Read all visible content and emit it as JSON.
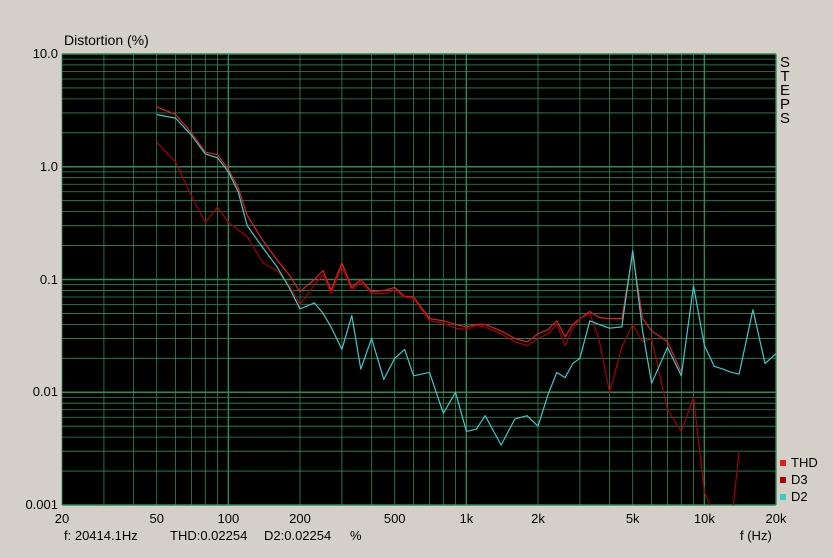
{
  "colors": {
    "background": "#d4d0c8",
    "plot_bg": "#000000",
    "grid": "#2e8b57",
    "thd": "#e02020",
    "d3": "#a80000",
    "d2": "#40c8c8"
  },
  "status": {
    "freq": "f: 20414.1Hz",
    "thd": "THD:0.02254",
    "d2": "D2:0.02254",
    "unit": "%"
  },
  "steps_label": [
    "S",
    "T",
    "E",
    "P",
    "S"
  ],
  "chart_data": {
    "type": "line",
    "ylabel": "Distortion (%)",
    "xlabel": "f (Hz)",
    "xscale": "log",
    "yscale": "log",
    "xlim": [
      20,
      20000
    ],
    "ylim": [
      0.001,
      10
    ],
    "grid": true,
    "legend_position": "bottom-right",
    "xticks": [
      {
        "v": 20,
        "label": "20"
      },
      {
        "v": 50,
        "label": "50"
      },
      {
        "v": 100,
        "label": "100"
      },
      {
        "v": 200,
        "label": "200"
      },
      {
        "v": 500,
        "label": "500"
      },
      {
        "v": 1000,
        "label": "1k"
      },
      {
        "v": 2000,
        "label": "2k"
      },
      {
        "v": 5000,
        "label": "5k"
      },
      {
        "v": 10000,
        "label": "10k"
      },
      {
        "v": 20000,
        "label": "20k"
      }
    ],
    "yticks": [
      {
        "v": 10,
        "label": "10.0"
      },
      {
        "v": 1,
        "label": "1.0"
      },
      {
        "v": 0.1,
        "label": "0.1"
      },
      {
        "v": 0.01,
        "label": "0.01"
      },
      {
        "v": 0.001,
        "label": "0.001"
      }
    ],
    "series": [
      {
        "name": "THD",
        "color": "#e02020",
        "points": [
          [
            50,
            3.4
          ],
          [
            60,
            2.9
          ],
          [
            70,
            2.0
          ],
          [
            80,
            1.35
          ],
          [
            90,
            1.28
          ],
          [
            100,
            0.95
          ],
          [
            110,
            0.65
          ],
          [
            120,
            0.37
          ],
          [
            140,
            0.22
          ],
          [
            160,
            0.15
          ],
          [
            180,
            0.11
          ],
          [
            200,
            0.078
          ],
          [
            230,
            0.1
          ],
          [
            250,
            0.12
          ],
          [
            270,
            0.08
          ],
          [
            300,
            0.14
          ],
          [
            330,
            0.085
          ],
          [
            360,
            0.1
          ],
          [
            400,
            0.078
          ],
          [
            450,
            0.08
          ],
          [
            500,
            0.085
          ],
          [
            550,
            0.071
          ],
          [
            600,
            0.07
          ],
          [
            700,
            0.045
          ],
          [
            800,
            0.043
          ],
          [
            900,
            0.04
          ],
          [
            1000,
            0.038
          ],
          [
            1100,
            0.04
          ],
          [
            1200,
            0.04
          ],
          [
            1400,
            0.035
          ],
          [
            1600,
            0.03
          ],
          [
            1800,
            0.028
          ],
          [
            2000,
            0.033
          ],
          [
            2200,
            0.036
          ],
          [
            2400,
            0.043
          ],
          [
            2600,
            0.031
          ],
          [
            2800,
            0.04
          ],
          [
            3000,
            0.045
          ],
          [
            3300,
            0.052
          ],
          [
            3600,
            0.046
          ],
          [
            4000,
            0.045
          ],
          [
            4500,
            0.045
          ],
          [
            5000,
            0.17
          ],
          [
            5500,
            0.045
          ],
          [
            6000,
            0.035
          ],
          [
            7000,
            0.028
          ],
          [
            8000,
            0.015
          ]
        ]
      },
      {
        "name": "D3",
        "color": "#a80000",
        "points": [
          [
            50,
            1.65
          ],
          [
            60,
            1.1
          ],
          [
            70,
            0.55
          ],
          [
            80,
            0.32
          ],
          [
            90,
            0.44
          ],
          [
            100,
            0.32
          ],
          [
            120,
            0.24
          ],
          [
            140,
            0.14
          ],
          [
            160,
            0.12
          ],
          [
            180,
            0.09
          ],
          [
            200,
            0.06
          ],
          [
            230,
            0.09
          ],
          [
            250,
            0.11
          ],
          [
            270,
            0.075
          ],
          [
            300,
            0.13
          ],
          [
            330,
            0.08
          ],
          [
            360,
            0.095
          ],
          [
            400,
            0.075
          ],
          [
            450,
            0.075
          ],
          [
            500,
            0.08
          ],
          [
            550,
            0.07
          ],
          [
            600,
            0.068
          ],
          [
            700,
            0.043
          ],
          [
            800,
            0.041
          ],
          [
            900,
            0.037
          ],
          [
            1000,
            0.036
          ],
          [
            1100,
            0.039
          ],
          [
            1200,
            0.038
          ],
          [
            1400,
            0.033
          ],
          [
            1600,
            0.028
          ],
          [
            1800,
            0.026
          ],
          [
            2000,
            0.03
          ],
          [
            2200,
            0.033
          ],
          [
            2400,
            0.04
          ],
          [
            2600,
            0.026
          ],
          [
            2800,
            0.037
          ],
          [
            3000,
            0.045
          ],
          [
            3300,
            0.05
          ],
          [
            3600,
            0.03
          ],
          [
            4000,
            0.01
          ],
          [
            4500,
            0.025
          ],
          [
            5000,
            0.04
          ],
          [
            5500,
            0.028
          ],
          [
            6000,
            0.03
          ],
          [
            7000,
            0.007
          ],
          [
            8000,
            0.0045
          ],
          [
            9000,
            0.009
          ],
          [
            10000,
            0.0013
          ],
          [
            11000,
            0.0008
          ],
          [
            12000,
            0.0009
          ],
          [
            13000,
            0.0007
          ],
          [
            14000,
            0.003
          ]
        ]
      },
      {
        "name": "D2",
        "color": "#40c8c8",
        "points": [
          [
            50,
            2.9
          ],
          [
            60,
            2.7
          ],
          [
            70,
            1.9
          ],
          [
            80,
            1.3
          ],
          [
            90,
            1.2
          ],
          [
            100,
            0.9
          ],
          [
            110,
            0.6
          ],
          [
            120,
            0.3
          ],
          [
            140,
            0.19
          ],
          [
            160,
            0.13
          ],
          [
            180,
            0.085
          ],
          [
            200,
            0.055
          ],
          [
            230,
            0.062
          ],
          [
            250,
            0.05
          ],
          [
            270,
            0.038
          ],
          [
            300,
            0.024
          ],
          [
            330,
            0.048
          ],
          [
            360,
            0.016
          ],
          [
            400,
            0.03
          ],
          [
            450,
            0.013
          ],
          [
            500,
            0.02
          ],
          [
            550,
            0.024
          ],
          [
            600,
            0.014
          ],
          [
            700,
            0.015
          ],
          [
            800,
            0.0065
          ],
          [
            900,
            0.01
          ],
          [
            1000,
            0.0045
          ],
          [
            1100,
            0.0047
          ],
          [
            1200,
            0.0062
          ],
          [
            1400,
            0.0034
          ],
          [
            1600,
            0.0058
          ],
          [
            1800,
            0.0062
          ],
          [
            2000,
            0.005
          ],
          [
            2200,
            0.0095
          ],
          [
            2400,
            0.015
          ],
          [
            2600,
            0.0135
          ],
          [
            2800,
            0.018
          ],
          [
            3000,
            0.02
          ],
          [
            3300,
            0.043
          ],
          [
            3600,
            0.04
          ],
          [
            4000,
            0.037
          ],
          [
            4500,
            0.038
          ],
          [
            5000,
            0.18
          ],
          [
            5500,
            0.035
          ],
          [
            6000,
            0.012
          ],
          [
            7000,
            0.025
          ],
          [
            8000,
            0.014
          ],
          [
            9000,
            0.088
          ],
          [
            10000,
            0.026
          ],
          [
            11000,
            0.017
          ],
          [
            12000,
            0.016
          ],
          [
            13000,
            0.015
          ],
          [
            14000,
            0.0145
          ],
          [
            16000,
            0.054
          ],
          [
            18000,
            0.018
          ],
          [
            20000,
            0.022
          ]
        ]
      }
    ]
  }
}
